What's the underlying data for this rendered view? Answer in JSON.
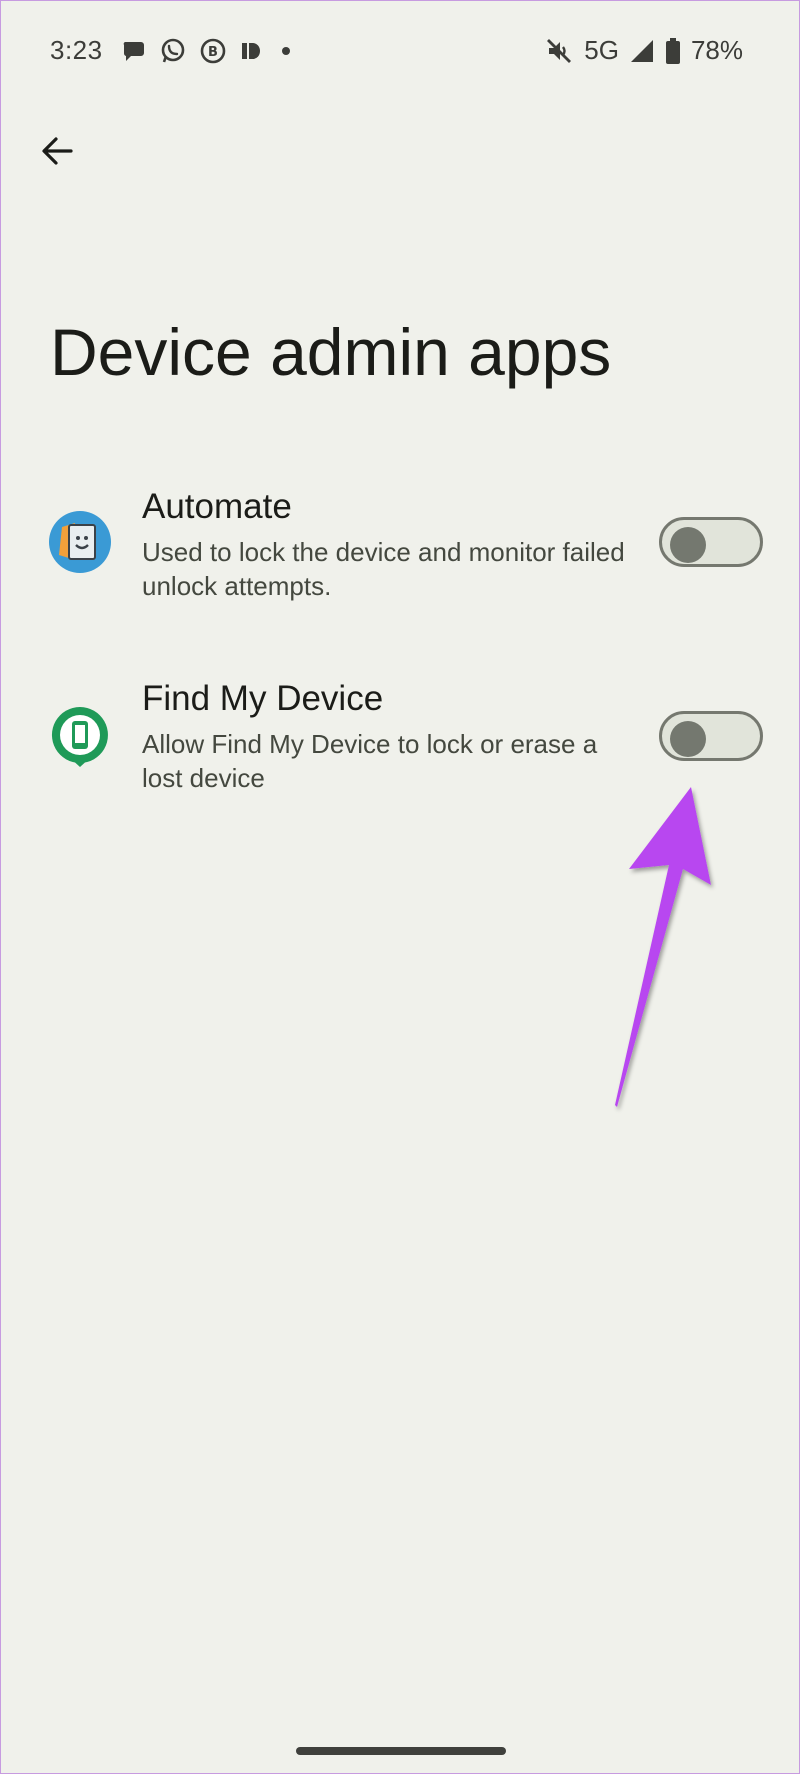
{
  "status_bar": {
    "time": "3:23",
    "network": "5G",
    "battery": "78%",
    "left_icons": [
      "chat-bubble-icon",
      "whatsapp-icon",
      "business-chat-icon",
      "docs-icon",
      "dot-icon"
    ],
    "right_icons": [
      "mute-icon",
      "signal-icon",
      "battery-icon"
    ]
  },
  "header": {
    "back_icon": "arrow-left-icon",
    "title": "Device admin apps"
  },
  "admin_apps": [
    {
      "name": "Automate",
      "description": "Used to lock the device and monitor failed unlock attempts.",
      "icon": "automate-app-icon",
      "enabled": false
    },
    {
      "name": "Find My Device",
      "description": "Allow Find My Device to lock or erase a lost device",
      "icon": "find-my-device-app-icon",
      "enabled": false
    }
  ],
  "annotation": {
    "color": "#b847f0",
    "icon": "arrow-annotation"
  },
  "colors": {
    "background": "#f0f1eb",
    "toggle_track": "#e1e4da",
    "toggle_border": "#75786f",
    "toggle_thumb": "#74786f"
  }
}
